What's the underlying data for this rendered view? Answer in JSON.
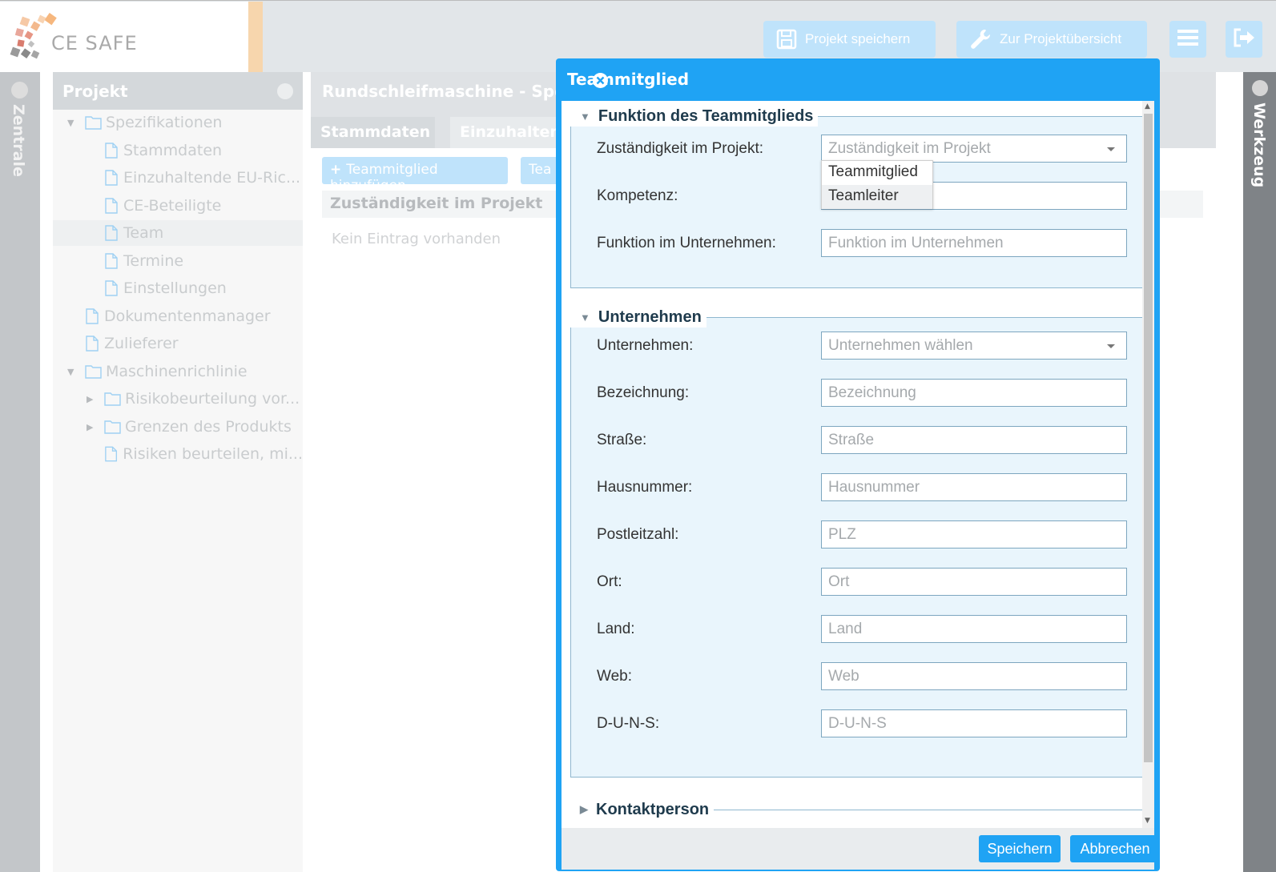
{
  "app": {
    "logo_text": "CE SAFE"
  },
  "header": {
    "save_label": "Projekt speichern",
    "overview_label": "Zur Projektübersicht"
  },
  "left_sidebar": {
    "label": "Zentrale"
  },
  "right_sidebar": {
    "label": "Werkzeug"
  },
  "project": {
    "title": "Projekt",
    "tree": [
      {
        "label": "Spezifikationen",
        "type": "folder",
        "expanded": true
      },
      {
        "label": "Stammdaten",
        "type": "file"
      },
      {
        "label": "Einzuhaltende EU-Ric...",
        "type": "file"
      },
      {
        "label": "CE-Beteiligte",
        "type": "file"
      },
      {
        "label": "Team",
        "type": "file",
        "selected": true
      },
      {
        "label": "Termine",
        "type": "file"
      },
      {
        "label": "Einstellungen",
        "type": "file"
      },
      {
        "label": "Dokumentenmanager",
        "type": "file"
      },
      {
        "label": "Zulieferer",
        "type": "file"
      },
      {
        "label": "Maschinenrichlinie",
        "type": "folder",
        "expanded": true
      },
      {
        "label": "Risikobeurteilung vor...",
        "type": "folder",
        "expanded": false
      },
      {
        "label": "Grenzen des Produkts",
        "type": "folder",
        "expanded": false
      },
      {
        "label": "Risiken beurteilen, mi...",
        "type": "file"
      }
    ]
  },
  "main": {
    "title": "Rundschleifmaschine - Spezifi",
    "tabs": [
      {
        "label": "Stammdaten"
      },
      {
        "label": "Einzuhalten"
      }
    ],
    "add_button": "Teammitglied hinzufügen",
    "second_button": "Tea",
    "column_header": "Zuständigkeit im Projekt",
    "empty_text": "Kein Eintrag vorhanden"
  },
  "modal": {
    "title": "Teammitglied",
    "section_function": {
      "legend": "Funktion des Teammitglieds",
      "fields": [
        {
          "label": "Zuständigkeit im Projekt:",
          "placeholder": "Zuständigkeit im Projekt",
          "type": "select"
        },
        {
          "label": "Kompetenz:",
          "placeholder": "",
          "type": "text"
        },
        {
          "label": "Funktion im Unternehmen:",
          "placeholder": "Funktion im Unternehmen",
          "type": "text"
        }
      ],
      "dropdown_options": [
        "Teammitglied",
        "Teamleiter"
      ]
    },
    "section_company": {
      "legend": "Unternehmen",
      "fields": [
        {
          "label": "Unternehmen:",
          "placeholder": "Unternehmen wählen",
          "type": "select"
        },
        {
          "label": "Bezeichnung:",
          "placeholder": "Bezeichnung",
          "type": "text"
        },
        {
          "label": "Straße:",
          "placeholder": "Straße",
          "type": "text"
        },
        {
          "label": "Hausnummer:",
          "placeholder": "Hausnummer",
          "type": "text"
        },
        {
          "label": "Postleitzahl:",
          "placeholder": "PLZ",
          "type": "text"
        },
        {
          "label": "Ort:",
          "placeholder": "Ort",
          "type": "text"
        },
        {
          "label": "Land:",
          "placeholder": "Land",
          "type": "text"
        },
        {
          "label": "Web:",
          "placeholder": "Web",
          "type": "text"
        },
        {
          "label": "D-U-N-S:",
          "placeholder": "D-U-N-S",
          "type": "text"
        }
      ]
    },
    "section_contact": {
      "legend": "Kontaktperson"
    },
    "save_label": "Speichern",
    "cancel_label": "Abbrechen"
  }
}
